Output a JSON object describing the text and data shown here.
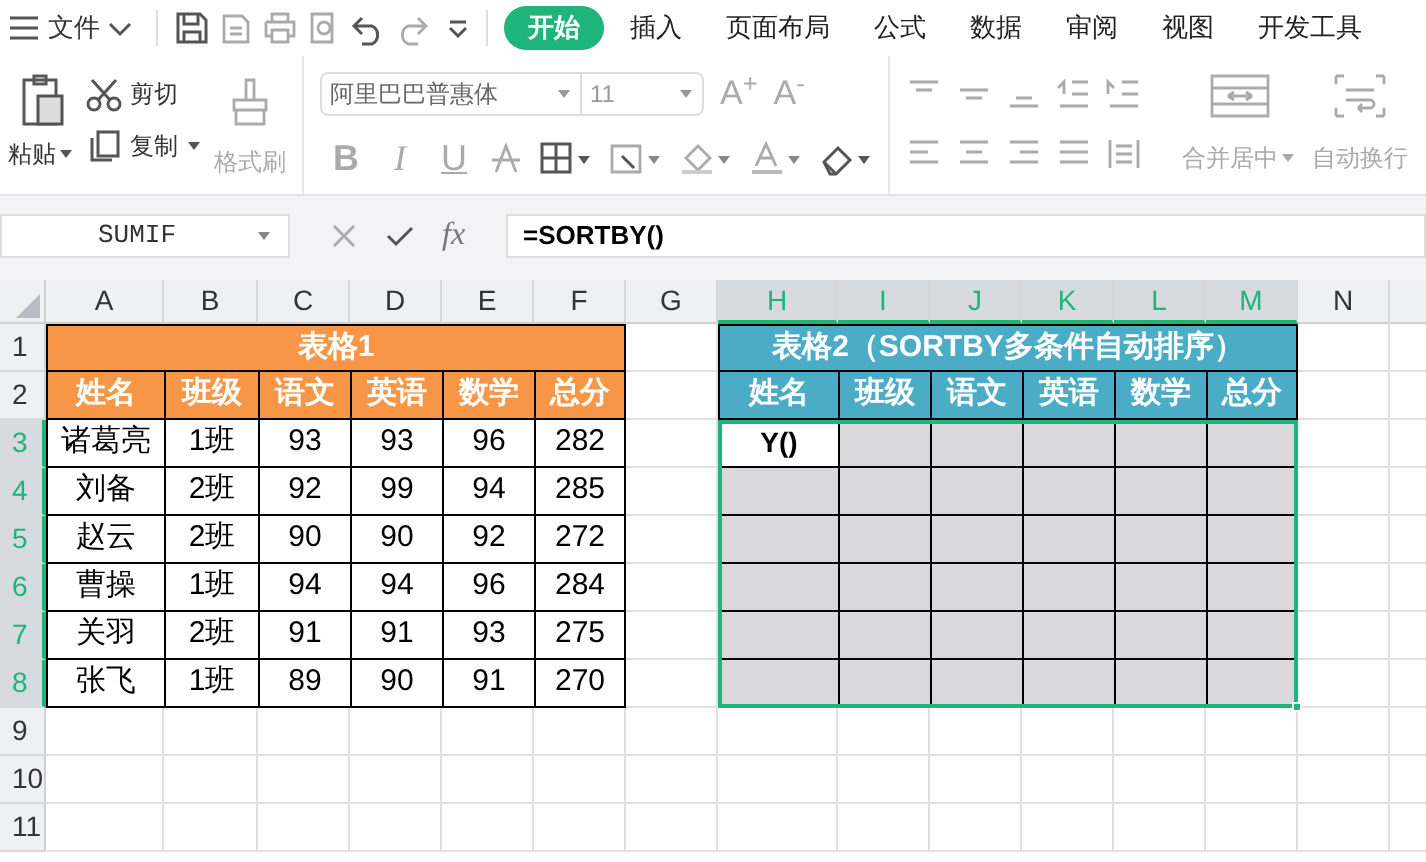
{
  "menu": {
    "label": "文件"
  },
  "tabs": [
    {
      "label": "开始",
      "selected": true
    },
    {
      "label": "插入",
      "selected": false
    },
    {
      "label": "页面布局",
      "selected": false
    },
    {
      "label": "公式",
      "selected": false
    },
    {
      "label": "数据",
      "selected": false
    },
    {
      "label": "审阅",
      "selected": false
    },
    {
      "label": "视图",
      "selected": false
    },
    {
      "label": "开发工具",
      "selected": false
    }
  ],
  "ribbon": {
    "paste": {
      "label": "粘贴"
    },
    "cut": {
      "label": "剪切"
    },
    "copy": {
      "label": "复制"
    },
    "format_painter": {
      "label": "格式刷",
      "disabled": true
    },
    "font_name": "阿里巴巴普惠体",
    "font_size": "11",
    "font_grow": "A$^{+}$",
    "font_shrink": "A$^{-}$",
    "style_buttons": [
      "B",
      "I",
      "U"
    ],
    "merge": {
      "label": "合并居中",
      "disabled": true
    },
    "wrap": {
      "label": "自动换行",
      "disabled": true
    }
  },
  "formula_bar": {
    "name_box": "SUMIF",
    "function_label": "fx",
    "formula": "=SORTBY()"
  },
  "sheet": {
    "columns": [
      {
        "label": "A",
        "selected": false
      },
      {
        "label": "B",
        "selected": false
      },
      {
        "label": "C",
        "selected": false
      },
      {
        "label": "D",
        "selected": false
      },
      {
        "label": "E",
        "selected": false
      },
      {
        "label": "F",
        "selected": false
      },
      {
        "label": "G",
        "selected": false
      },
      {
        "label": "H",
        "selected": true
      },
      {
        "label": "I",
        "selected": true
      },
      {
        "label": "J",
        "selected": true
      },
      {
        "label": "K",
        "selected": true
      },
      {
        "label": "L",
        "selected": true
      },
      {
        "label": "M",
        "selected": true
      },
      {
        "label": "N",
        "selected": false
      }
    ],
    "rows": [
      {
        "label": "1",
        "selected": false
      },
      {
        "label": "2",
        "selected": false
      },
      {
        "label": "3",
        "selected": true
      },
      {
        "label": "4",
        "selected": true
      },
      {
        "label": "5",
        "selected": true
      },
      {
        "label": "6",
        "selected": true
      },
      {
        "label": "7",
        "selected": true
      },
      {
        "label": "8",
        "selected": true
      },
      {
        "label": "9",
        "selected": false
      },
      {
        "label": "10",
        "selected": false
      },
      {
        "label": "11",
        "selected": false
      }
    ],
    "table1": {
      "title": "表格1",
      "headers": [
        "姓名",
        "班级",
        "语文",
        "英语",
        "数学",
        "总分"
      ],
      "rows": [
        [
          "诸葛亮",
          "1班",
          "93",
          "93",
          "96",
          "282"
        ],
        [
          "刘备",
          "2班",
          "92",
          "99",
          "94",
          "285"
        ],
        [
          "赵云",
          "2班",
          "90",
          "90",
          "92",
          "272"
        ],
        [
          "曹操",
          "1班",
          "94",
          "94",
          "96",
          "284"
        ],
        [
          "关羽",
          "2班",
          "91",
          "91",
          "93",
          "275"
        ],
        [
          "张飞",
          "1班",
          "89",
          "90",
          "91",
          "270"
        ]
      ]
    },
    "table2": {
      "title": "表格2（SORTBY多条件自动排序）",
      "headers": [
        "姓名",
        "班级",
        "语文",
        "英语",
        "数学",
        "总分"
      ],
      "editing_text": "Y()"
    }
  }
}
